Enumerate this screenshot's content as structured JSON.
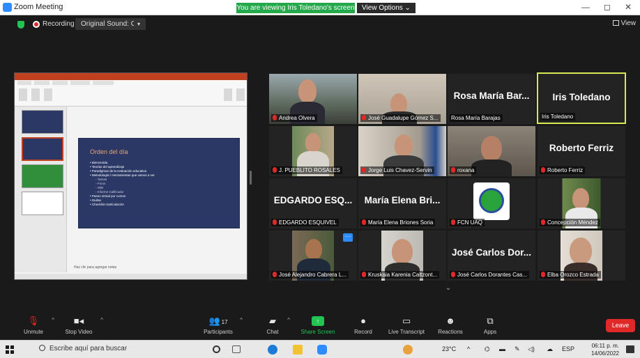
{
  "window": {
    "title": "Zoom Meeting",
    "banner": "You are viewing Iris Toledano's screen",
    "view_options": "View Options ⌄",
    "controls": [
      "—",
      "◻",
      "✕"
    ]
  },
  "topbar": {
    "recording_label": "Recording",
    "original_sound": "Original Sound: Off",
    "view_label": "View"
  },
  "shared_screen": {
    "slide_title": "Orden del día",
    "bullets": [
      {
        "text": "• Bienvenida",
        "sub": false
      },
      {
        "text": "• Teorías del aprendizaje",
        "sub": false
      },
      {
        "text": "• Paradigmas de la evaluación educativa",
        "sub": false
      },
      {
        "text": "• Metodología / Herramientas que vamos a ver",
        "sub": false
      },
      {
        "text": "◦ Tareas",
        "sub": true
      },
      {
        "text": "◦ Foros",
        "sub": true
      },
      {
        "text": "◦ Wiki",
        "sub": true
      },
      {
        "text": "◦ Informe Calificador",
        "sub": true
      },
      {
        "text": "• Paseo virtual por cursos",
        "sub": false
      },
      {
        "text": "• Dudas",
        "sub": false
      },
      {
        "text": "• Checklist matriculación",
        "sub": false
      }
    ],
    "notes_placeholder": "Haz clic para agregar notas"
  },
  "participants": [
    {
      "name": "Andrea Olvera",
      "video": true
    },
    {
      "name": "José Guadalupe Gómez S...",
      "video": true
    },
    {
      "name": "Rosa María Barajas",
      "big": "Rosa María Bar...",
      "video": false
    },
    {
      "name": "Iris Toledano",
      "big": "Iris Toledano",
      "video": false,
      "active": true
    },
    {
      "name": "J. PUEBLITO ROSALES",
      "video": true
    },
    {
      "name": "Jorge Luis Chavez-Servin",
      "video": true
    },
    {
      "name": "roxana",
      "video": true
    },
    {
      "name": "Roberto Ferriz",
      "big": "Roberto Ferriz",
      "video": false
    },
    {
      "name": "EDGARDO ESQUIVEL",
      "big": "EDGARDO ESQ...",
      "video": false
    },
    {
      "name": "María Elena Briones Soria",
      "big": "María Elena Bri...",
      "video": false
    },
    {
      "name": "FCN UAQ",
      "video": true
    },
    {
      "name": "Concepción Méndez",
      "video": true
    },
    {
      "name": "José Alejandro Cabrera L...",
      "video": true
    },
    {
      "name": "Kruskaia Karenia Caltzont...",
      "video": true
    },
    {
      "name": "José Carlos Dorantes Cas...",
      "big": "José Carlos Dor...",
      "video": false
    },
    {
      "name": "Elba Orozco Estrada",
      "video": true
    }
  ],
  "toolbar": {
    "unmute": "Unmute",
    "stop_video": "Stop Video",
    "participants": "Participants",
    "participants_count": "17",
    "chat": "Chat",
    "share_screen": "Share Screen",
    "record": "Record",
    "live_transcript": "Live Transcript",
    "reactions": "Reactions",
    "apps": "Apps",
    "leave": "Leave"
  },
  "taskbar": {
    "search_placeholder": "Escribe aquí para buscar",
    "temperature": "23°C",
    "language": "ESP",
    "time": "06:11 p. m.",
    "date": "14/06/2022"
  },
  "colors": {
    "accent_green": "#23c552",
    "banner_green": "#23a84a",
    "leave_red": "#e02828",
    "active_border": "#d7ea4f",
    "zoom_blue": "#2d8cff"
  }
}
